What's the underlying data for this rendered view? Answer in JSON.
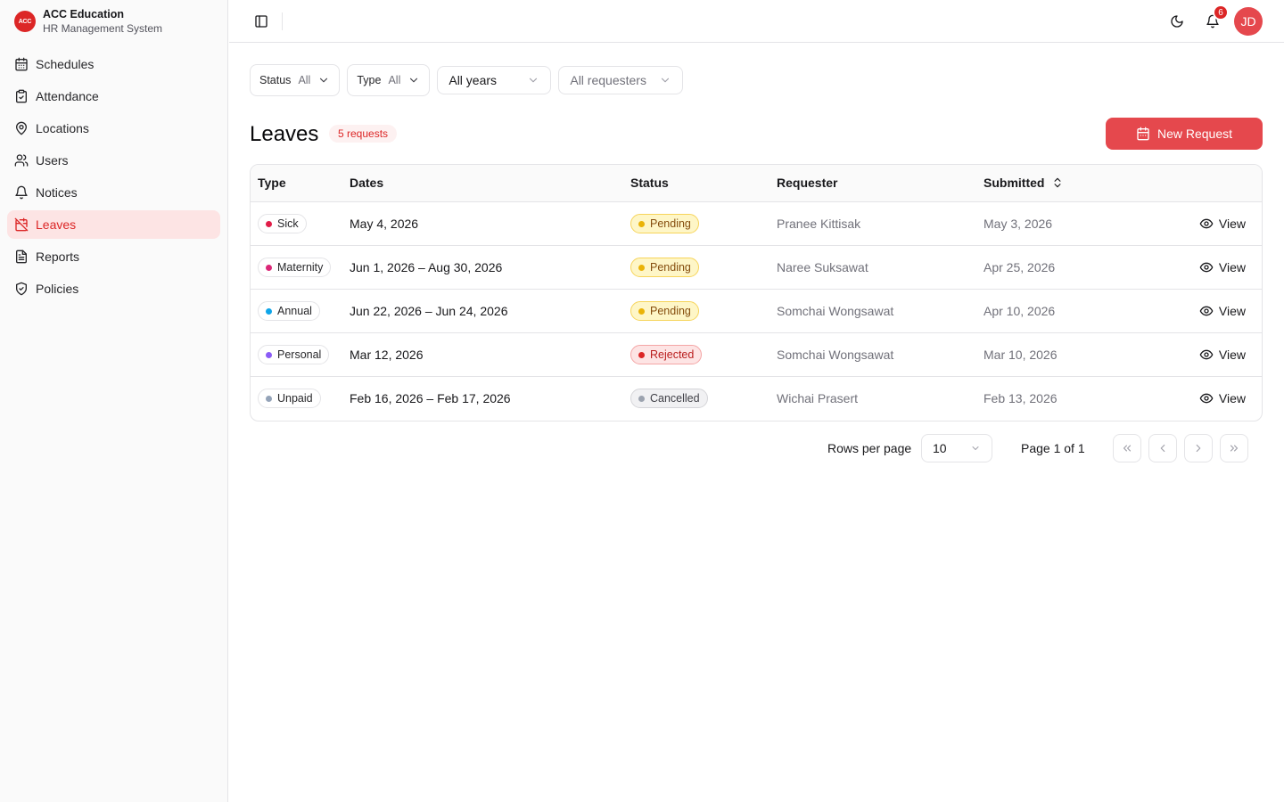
{
  "brand": {
    "logo_text": "ACC",
    "title": "ACC Education",
    "subtitle": "HR Management System"
  },
  "sidebar": {
    "items": [
      {
        "label": "Schedules",
        "icon": "calendar-icon"
      },
      {
        "label": "Attendance",
        "icon": "clipboard-check-icon"
      },
      {
        "label": "Locations",
        "icon": "map-pin-icon"
      },
      {
        "label": "Users",
        "icon": "users-icon"
      },
      {
        "label": "Notices",
        "icon": "bell-icon"
      },
      {
        "label": "Leaves",
        "icon": "calendar-off-icon",
        "active": true
      },
      {
        "label": "Reports",
        "icon": "file-text-icon"
      },
      {
        "label": "Policies",
        "icon": "shield-check-icon"
      }
    ]
  },
  "header": {
    "notification_count": "6",
    "avatar_initials": "JD"
  },
  "filters": {
    "status": {
      "label": "Status",
      "value": "All"
    },
    "type": {
      "label": "Type",
      "value": "All"
    },
    "years": {
      "value": "All years"
    },
    "requesters": {
      "placeholder": "All requesters"
    }
  },
  "page": {
    "title": "Leaves",
    "count_badge": "5 requests",
    "new_button": "New Request"
  },
  "table": {
    "columns": [
      "Type",
      "Dates",
      "Status",
      "Requester",
      "Submitted"
    ],
    "view_label": "View",
    "rows": [
      {
        "type": "Sick",
        "type_color": "#e11d48",
        "dates": "May 4, 2026",
        "status": "Pending",
        "status_kind": "pending",
        "requester": "Pranee Kittisak",
        "submitted": "May 3, 2026"
      },
      {
        "type": "Maternity",
        "type_color": "#db2777",
        "dates": "Jun 1, 2026 – Aug 30, 2026",
        "status": "Pending",
        "status_kind": "pending",
        "requester": "Naree Suksawat",
        "submitted": "Apr 25, 2026"
      },
      {
        "type": "Annual",
        "type_color": "#0ea5e9",
        "dates": "Jun 22, 2026 – Jun 24, 2026",
        "status": "Pending",
        "status_kind": "pending",
        "requester": "Somchai Wongsawat",
        "submitted": "Apr 10, 2026"
      },
      {
        "type": "Personal",
        "type_color": "#8b5cf6",
        "dates": "Mar 12, 2026",
        "status": "Rejected",
        "status_kind": "rejected",
        "requester": "Somchai Wongsawat",
        "submitted": "Mar 10, 2026"
      },
      {
        "type": "Unpaid",
        "type_color": "#94a3b8",
        "dates": "Feb 16, 2026 – Feb 17, 2026",
        "status": "Cancelled",
        "status_kind": "cancelled",
        "requester": "Wichai Prasert",
        "submitted": "Feb 13, 2026"
      }
    ]
  },
  "pagination": {
    "rows_label": "Rows per page",
    "rows_value": "10",
    "page_info": "Page 1 of 1"
  },
  "colors": {
    "accent": "#e5484d",
    "pending_dot": "#eab308",
    "rejected_dot": "#dc2626",
    "cancelled_dot": "#9ca3af"
  }
}
